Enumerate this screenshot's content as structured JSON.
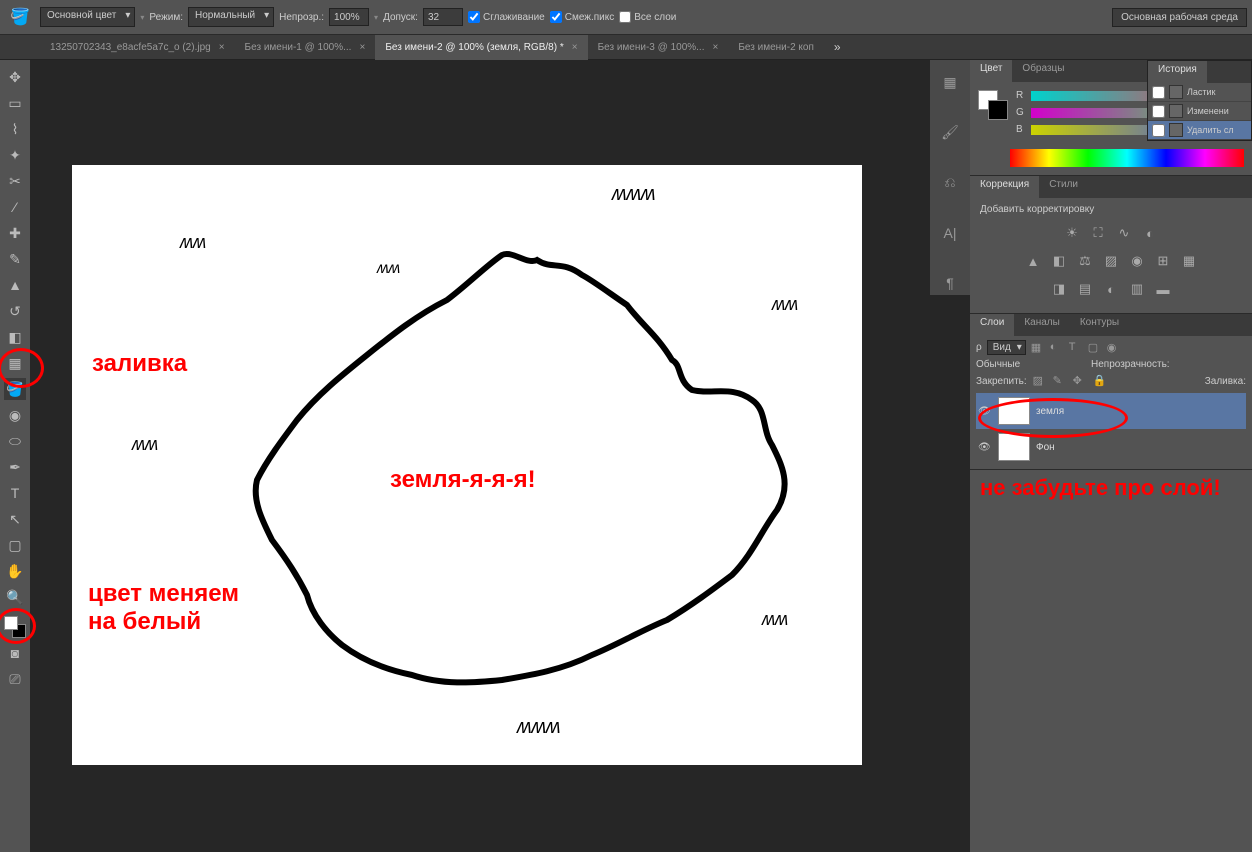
{
  "options": {
    "fg_label": "Основной цвет",
    "mode_label": "Режим:",
    "mode_value": "Нормальный",
    "opacity_label": "Непрозр.:",
    "opacity_value": "100%",
    "tolerance_label": "Допуск:",
    "tolerance_value": "32",
    "antialias": "Сглаживание",
    "contiguous": "Смеж.пикс",
    "all_layers": "Все слои",
    "workspace": "Основная рабочая среда"
  },
  "tabs": [
    {
      "label": "13250702343_e8acfe5a7c_o (2).jpg",
      "active": false
    },
    {
      "label": "Без имени-1 @ 100%...",
      "active": false
    },
    {
      "label": "Без имени-2 @ 100% (земля, RGB/8) *",
      "active": true
    },
    {
      "label": "Без имени-3 @ 100%...",
      "active": false
    },
    {
      "label": "Без имени-2 коп",
      "active": false
    }
  ],
  "panels": {
    "color": {
      "tab1": "Цвет",
      "tab2": "Образцы",
      "r": "R",
      "g": "G",
      "b": "B"
    },
    "history": {
      "title": "История",
      "items": [
        "Ластик",
        "Изменени",
        "Удалить сл"
      ]
    },
    "adjustments": {
      "tab1": "Коррекция",
      "tab2": "Стили",
      "add": "Добавить корректировку"
    },
    "layers": {
      "tab1": "Слои",
      "tab2": "Каналы",
      "tab3": "Контуры",
      "kind": "Вид",
      "blend": "Обычные",
      "opacity_label": "Непрозрачность:",
      "lock_label": "Закрепить:",
      "fill_label": "Заливка:",
      "items": [
        {
          "name": "земля",
          "active": true
        },
        {
          "name": "Фон",
          "active": false
        }
      ]
    }
  },
  "annotations": {
    "fill": "заливка",
    "center": "земля-я-я-я!",
    "color_change": "цвет меняем\nна белый",
    "layer_note": "не забудьте про слой!"
  }
}
